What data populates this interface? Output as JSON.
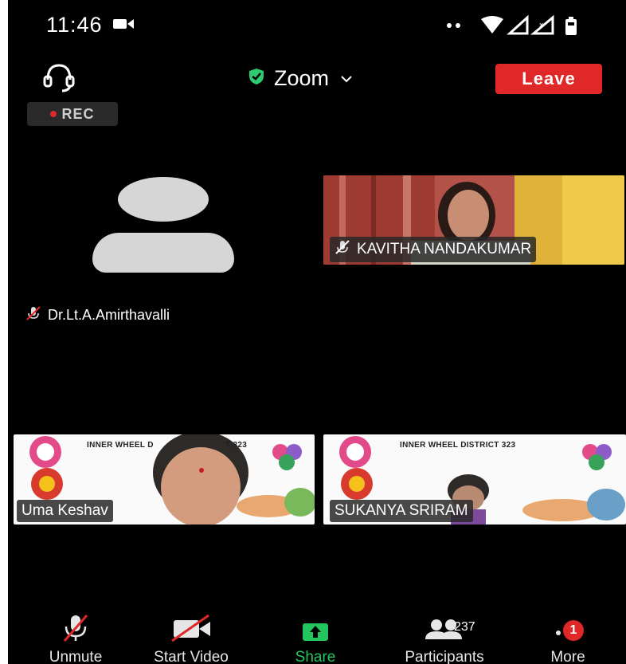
{
  "status_bar": {
    "time": "11:46"
  },
  "header": {
    "title": "Zoom",
    "leave_label": "Leave",
    "rec_label": "REC"
  },
  "participants": [
    {
      "name": "Dr.Lt.A.Amirthavalli",
      "video": false,
      "muted": true
    },
    {
      "name": "KAVITHA NANDAKUMAR",
      "video": true,
      "muted": true
    },
    {
      "name": "Uma Keshav",
      "video": true,
      "muted": false,
      "banner": "INNER WHEEL D"
    },
    {
      "name": "SUKANYA SRIRAM",
      "video": true,
      "muted": false,
      "banner": "INNER WHEEL DISTRICT 323"
    }
  ],
  "banner_suffix": "T 323",
  "toolbar": {
    "unmute": "Unmute",
    "start_video": "Start Video",
    "share": "Share",
    "participants": "Participants",
    "participants_count": "237",
    "more": "More",
    "more_badge": "1"
  },
  "colors": {
    "leave": "#e02828",
    "share": "#23c55e",
    "shield": "#2ecc71",
    "background": "#000000"
  },
  "icons": [
    "video-camera-icon",
    "signal-dots-icon",
    "wifi-icon",
    "cell-signal-icon",
    "battery-icon",
    "headset-icon",
    "shield-check-icon",
    "chevron-down-icon",
    "mic-muted-icon",
    "video-muted-icon",
    "share-arrow-icon",
    "participants-icon",
    "more-dots-icon"
  ]
}
